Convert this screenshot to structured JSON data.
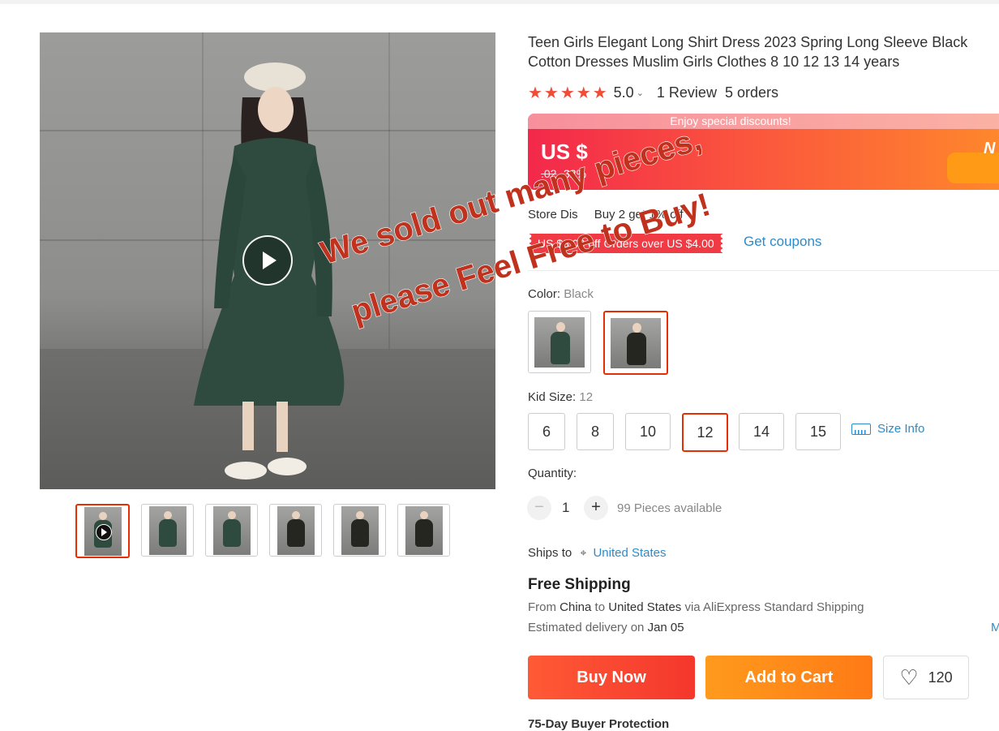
{
  "colors": {
    "accent": "#e62e04",
    "link": "#2e8bc9",
    "buy": "#f4372c",
    "cart": "#ff8a1a",
    "star": "#f04d39"
  },
  "product": {
    "title": "Teen Girls Elegant Long Shirt Dress 2023 Spring Long Sleeve Black Cotton Dresses Muslim Girls Clothes 8 10 12 13 14 years",
    "stars": "★★★★★",
    "rating": "5.0",
    "reviews": "1 Review",
    "orders": "5 orders"
  },
  "promo": {
    "banner": "Enjoy special discounts!",
    "price": "US $",
    "original": ".02",
    "discount": "-32%",
    "right_label": "N"
  },
  "store": {
    "discount_prefix": "Store Dis",
    "discount_text": "Buy 2 get 1% off",
    "coupon": "US $3.00 off Orders over US $4.00",
    "get_coupons": "Get coupons"
  },
  "color": {
    "label": "Color:",
    "selected": "Black",
    "swatches": [
      {
        "name": "Green",
        "hex": "#2f4a3e"
      },
      {
        "name": "Black",
        "hex": "#262620"
      }
    ]
  },
  "size": {
    "label": "Kid Size:",
    "selected": "12",
    "options": [
      "6",
      "8",
      "10",
      "12",
      "14",
      "15"
    ],
    "info": "Size Info"
  },
  "quantity": {
    "label": "Quantity:",
    "minus": "−",
    "plus": "+",
    "value": "1",
    "available": "99 Pieces available"
  },
  "shipping": {
    "ships_to_label": "Ships to",
    "destination": "United States",
    "free": "Free Shipping",
    "from_label": "From",
    "from": "China",
    "to_label": "to",
    "to": "United States",
    "via": "via AliExpress Standard Shipping",
    "est_label": "Estimated delivery on",
    "est_date": "Jan 05",
    "more": "M"
  },
  "actions": {
    "buy_now": "Buy Now",
    "add_to_cart": "Add to Cart",
    "wishlist_count": "120",
    "buyer_protection": "75-Day Buyer Protection"
  },
  "overlay": {
    "line1": "We sold out many pieces,",
    "line2": "please Feel Free to Buy!"
  },
  "gallery": {
    "thumbs": [
      {
        "hex": "#2f4a3e",
        "video": true
      },
      {
        "hex": "#2f4a3e",
        "video": false
      },
      {
        "hex": "#2f4a3e",
        "video": false
      },
      {
        "hex": "#262620",
        "video": false
      },
      {
        "hex": "#262620",
        "video": false
      },
      {
        "hex": "#262620",
        "video": false
      }
    ]
  }
}
